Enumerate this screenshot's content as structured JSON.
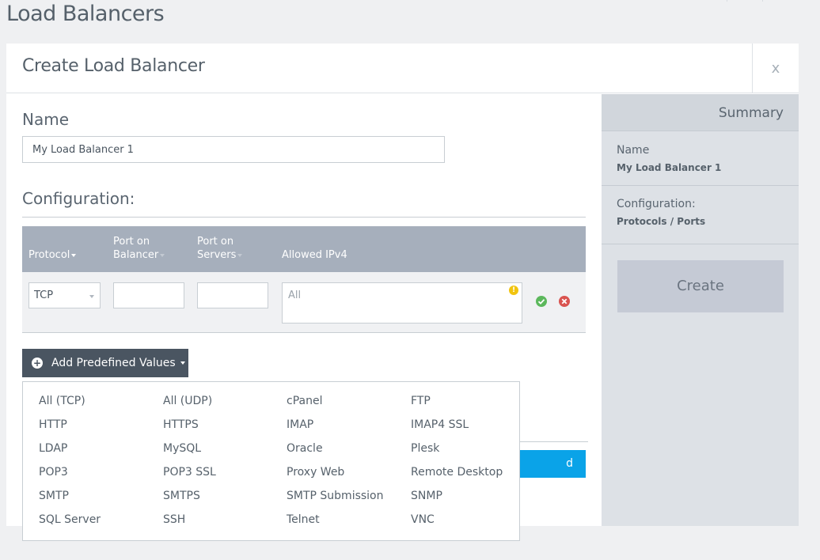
{
  "page": {
    "title": "Load Balancers"
  },
  "modal": {
    "title": "Create Load Balancer",
    "close_label": "x"
  },
  "form": {
    "name_label": "Name",
    "name_value": "My Load Balancer 1",
    "config_label": "Configuration:"
  },
  "config_table": {
    "headers": {
      "protocol": "Protocol",
      "port_balancer_1": "Port on",
      "port_balancer_2": "Balancer",
      "port_servers_1": "Port on",
      "port_servers_2": "Servers",
      "allowed_ipv4": "Allowed IPv4"
    },
    "row": {
      "protocol": "TCP",
      "port_balancer": "",
      "port_servers": "",
      "ipv4_placeholder": "All",
      "warning_glyph": "!"
    }
  },
  "predefined": {
    "button_label": "Add Predefined Values",
    "items": [
      [
        "All (TCP)",
        "All (UDP)",
        "cPanel",
        "FTP"
      ],
      [
        "HTTP",
        "HTTPS",
        "IMAP",
        "IMAP4 SSL"
      ],
      [
        "LDAP",
        "MySQL",
        "Oracle",
        "Plesk"
      ],
      [
        "POP3",
        "POP3 SSL",
        "Proxy Web",
        "Remote Desktop"
      ],
      [
        "SMTP",
        "SMTPS",
        "SMTP Submission",
        "SNMP"
      ],
      [
        "SQL Server",
        "SSH",
        "Telnet",
        "VNC"
      ]
    ]
  },
  "region_button": {
    "label": "d Kingdom"
  },
  "summary": {
    "title": "Summary",
    "name_label": "Name",
    "name_value": "My Load Balancer 1",
    "config_label": "Configuration:",
    "config_value": "Protocols / Ports",
    "create_label": "Create"
  },
  "colors": {
    "accent_blue": "#0aa3e8",
    "table_header": "#a6afbc",
    "dark_button": "#4a5561",
    "ok_green": "#5cb85c",
    "remove_red": "#d9534f",
    "warning_yellow": "#f1c40f"
  }
}
